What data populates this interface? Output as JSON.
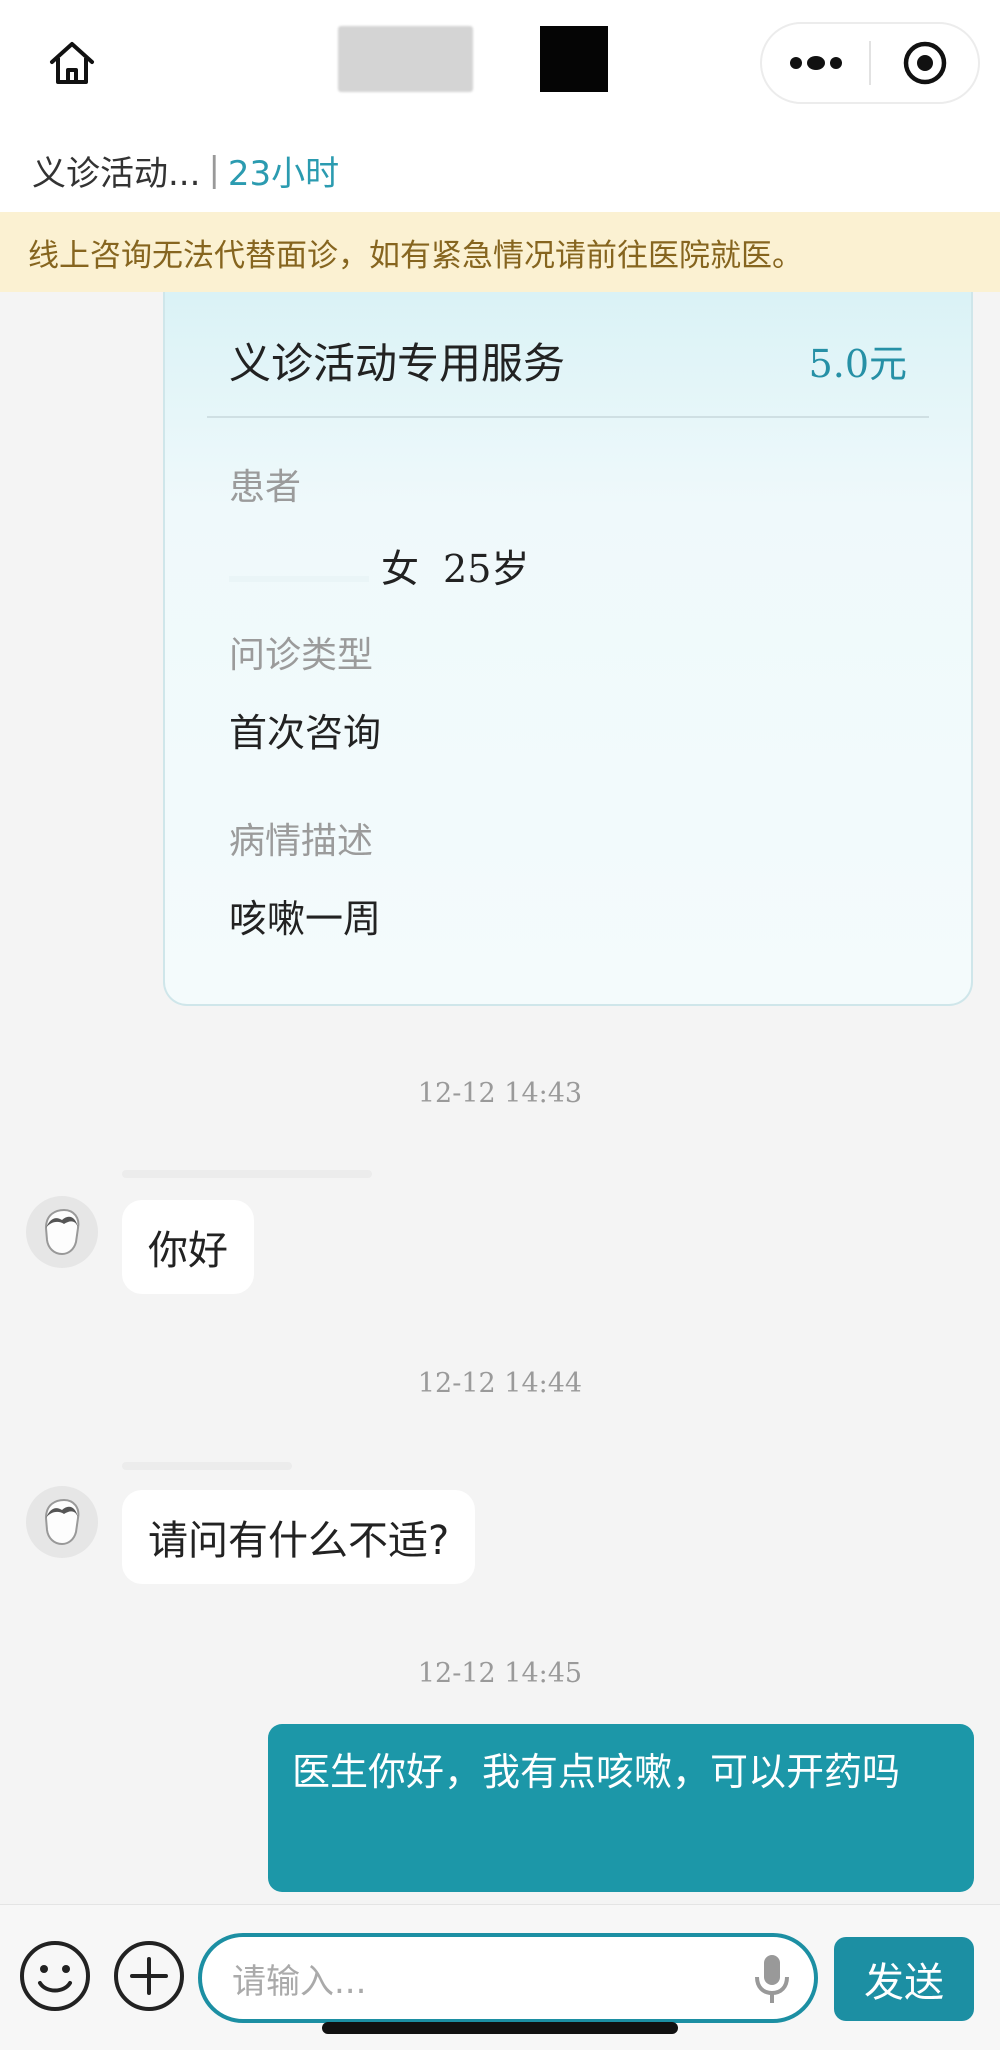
{
  "navbar": {
    "home_icon": "home-icon",
    "more_icon": "more-icon",
    "close_icon": "close-icon"
  },
  "title_row": {
    "name": "义诊活动...",
    "separator": "|",
    "remaining": "23小时"
  },
  "notice": {
    "text": "线上咨询无法代替面诊，如有紧急情况请前往医院就医。"
  },
  "service_card": {
    "title": "义诊活动专用服务",
    "price": "5.0元",
    "patient_label": "患者",
    "patient_gender": "女",
    "patient_age": "25岁",
    "consult_type_label": "问诊类型",
    "consult_type_value": "首次咨询",
    "condition_label": "病情描述",
    "condition_value": "咳嗽一周"
  },
  "messages": [
    {
      "timestamp": "12-12 14:43",
      "side": "left",
      "text": "你好"
    },
    {
      "timestamp": "12-12 14:44",
      "side": "left",
      "text": "请问有什么不适?"
    },
    {
      "timestamp": "12-12 14:45",
      "side": "right",
      "text": "医生你好，我有点咳嗽，可以开药吗"
    }
  ],
  "input_bar": {
    "emoji_icon": "emoji-icon",
    "plus_icon": "plus-icon",
    "placeholder": "请输入...",
    "mic_icon": "microphone-icon",
    "send_label": "发送"
  },
  "colors": {
    "accent": "#1c8fa3",
    "notice_bg": "#fbf1d2",
    "notice_text": "#86651f"
  }
}
